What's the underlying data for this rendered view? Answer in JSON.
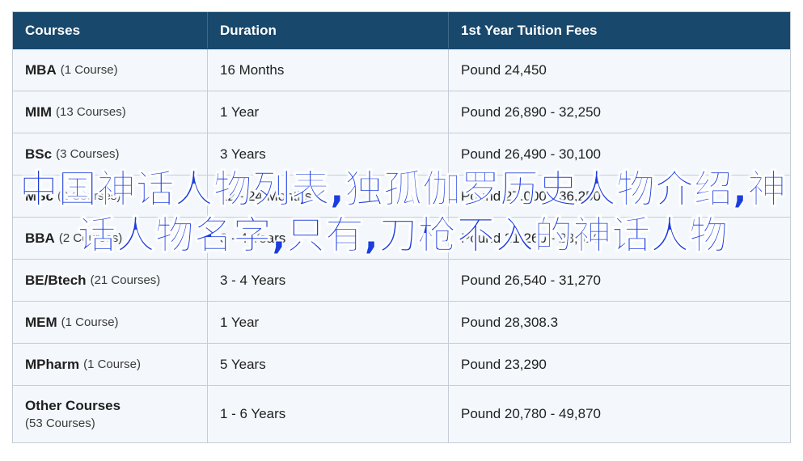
{
  "table": {
    "headers": [
      "Courses",
      "Duration",
      "1st Year Tuition Fees"
    ],
    "rows": [
      {
        "course": "MBA",
        "count": "(1 Course)",
        "duration": "16 Months",
        "fees": "Pound 24,450"
      },
      {
        "course": "MIM",
        "count": "(13 Courses)",
        "duration": "1 Year",
        "fees": "Pound 26,890 - 32,250"
      },
      {
        "course": "BSc",
        "count": "(3 Courses)",
        "duration": "3 Years",
        "fees": "Pound 26,490 - 30,100"
      },
      {
        "course": "MSc",
        "count": "(2 Courses)",
        "duration": "12 - 24 Months",
        "fees": "Pound 27,000 - 36,250"
      },
      {
        "course": "BBA",
        "count": "(2 Courses)",
        "duration": "3 - 4 Years",
        "fees": "Pound 21,260 - 28,610"
      },
      {
        "course": "BE/Btech",
        "count": "(21 Courses)",
        "duration": "3 - 4 Years",
        "fees": "Pound 26,540 - 31,270"
      },
      {
        "course": "MEM",
        "count": "(1 Course)",
        "duration": "1 Year",
        "fees": "Pound 28,308.3"
      },
      {
        "course": "MPharm",
        "count": "(1 Course)",
        "duration": "5 Years",
        "fees": "Pound 23,290"
      },
      {
        "course": "Other Courses",
        "count": "(53 Courses)",
        "duration": "1 - 6 Years",
        "fees": "Pound 20,780 - 49,870"
      }
    ]
  },
  "overlay_text": "中国神话人物列表,独孤伽罗历史人物介绍,神话人物名字,只有,刀枪不入的神话人物"
}
